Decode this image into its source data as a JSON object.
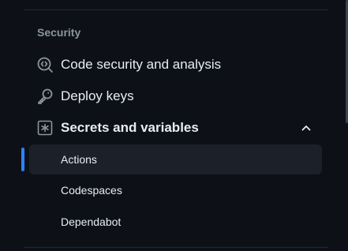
{
  "section": {
    "heading": "Security"
  },
  "nav": {
    "code_security": {
      "label": "Code security and analysis",
      "icon": "codescan-icon"
    },
    "deploy_keys": {
      "label": "Deploy keys",
      "icon": "key-icon"
    },
    "secrets": {
      "label": "Secrets and variables",
      "icon": "asterisk-icon",
      "expanded": true,
      "sub_items": [
        {
          "label": "Actions",
          "active": true
        },
        {
          "label": "Codespaces",
          "active": false
        },
        {
          "label": "Dependabot",
          "active": false
        }
      ]
    }
  },
  "colors": {
    "background": "#0d1117",
    "text": "#e6edf3",
    "muted": "#8b949e",
    "active_bg": "#1c2129",
    "accent": "#2f81f7",
    "divider": "#21262d"
  }
}
